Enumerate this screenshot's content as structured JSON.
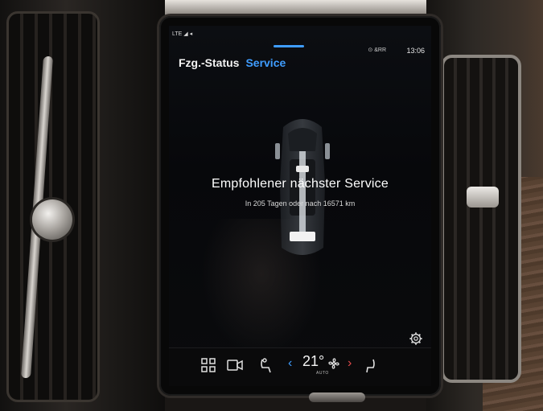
{
  "status_bar": {
    "network": "LTE",
    "indicators": "⊙ &RR",
    "time": "13:06"
  },
  "tabs": [
    {
      "label": "Fzg.-Status",
      "active": false
    },
    {
      "label": "Service",
      "active": true
    }
  ],
  "service": {
    "headline": "Empfohlener nächster Service",
    "detail": "In 205 Tagen oder nach 16571 km"
  },
  "climate": {
    "temperature": "21°",
    "mode": "AUTO"
  },
  "icons": {
    "apps": "grid-icon",
    "camera": "camera-icon",
    "seat_left": "seat-heat-icon",
    "fan": "fan-icon",
    "seat_right": "seat-icon",
    "settings": "gear-icon"
  },
  "colors": {
    "accent": "#3f9dff",
    "warm": "#e14a4a",
    "screen_bg": "#07080b"
  }
}
